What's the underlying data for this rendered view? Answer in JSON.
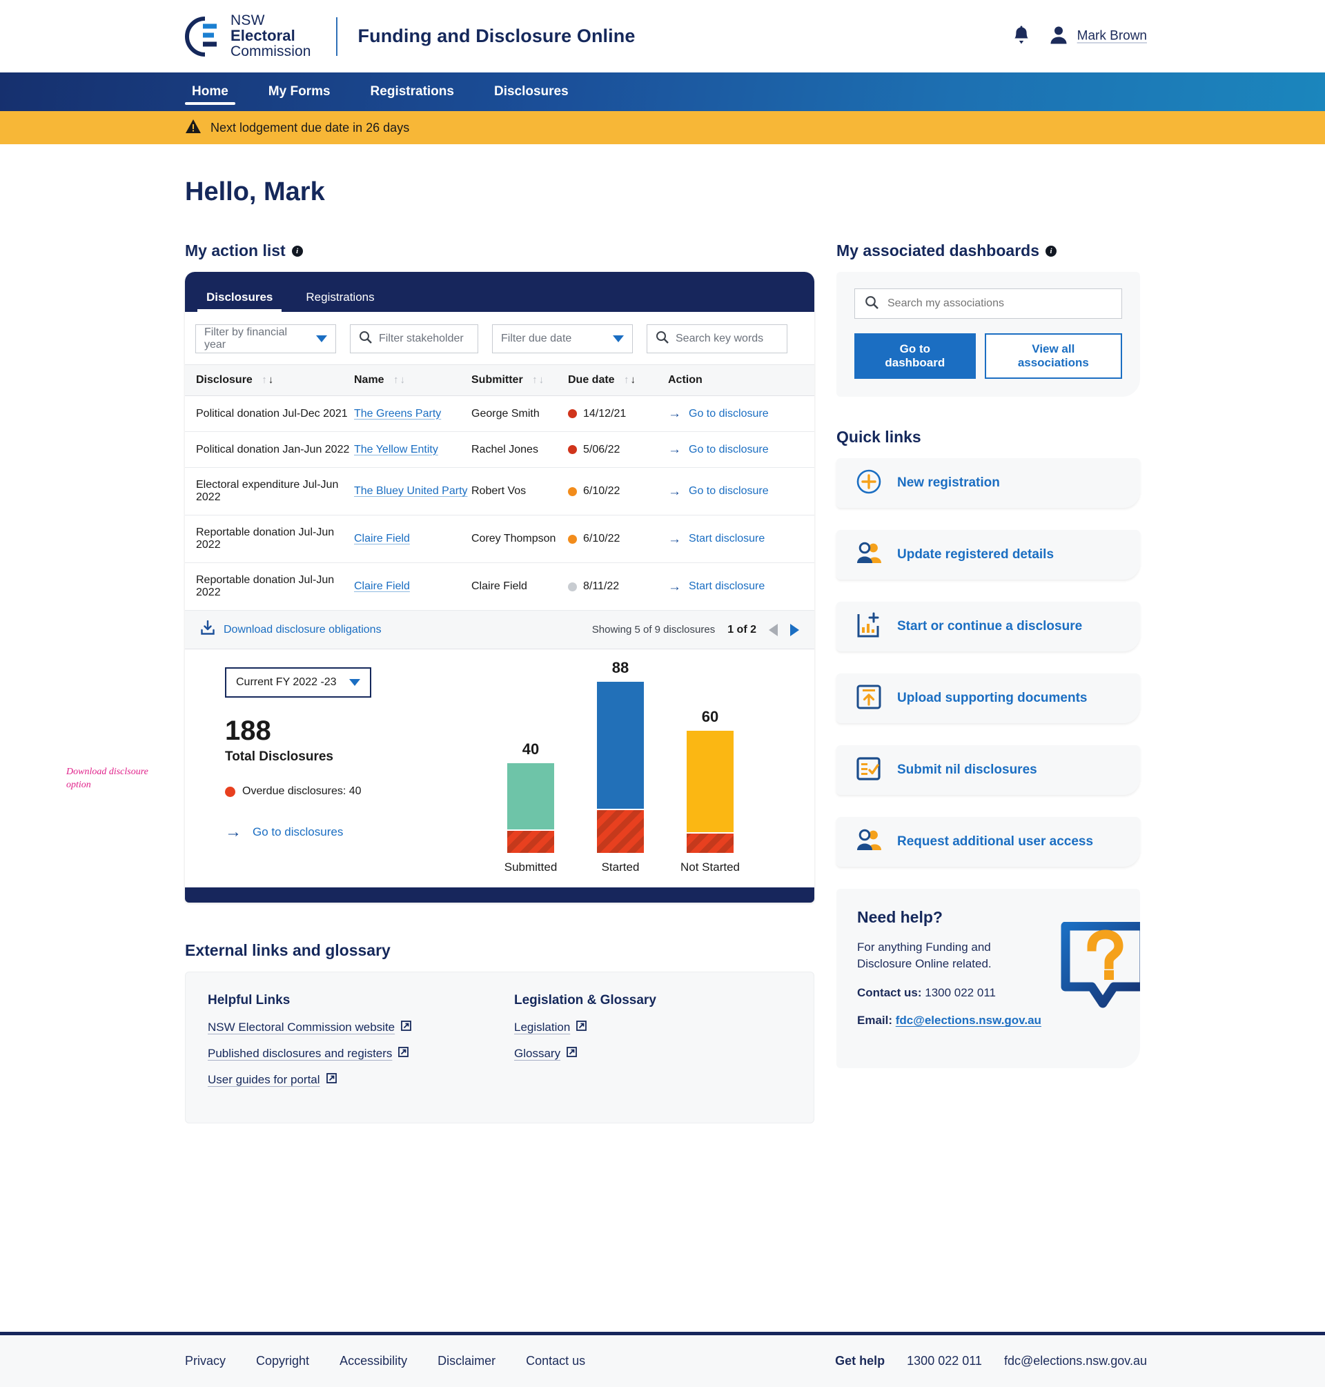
{
  "header": {
    "logo": {
      "line1": "NSW",
      "line2": "Electoral",
      "line3": "Commission"
    },
    "app_title": "Funding and Disclosure Online",
    "notifications_icon": "bell-icon",
    "avatar_icon": "user-avatar-icon",
    "user_name": "Mark Brown"
  },
  "nav": {
    "items": [
      {
        "label": "Home",
        "active": true
      },
      {
        "label": "My Forms",
        "active": false
      },
      {
        "label": "Registrations",
        "active": false
      },
      {
        "label": "Disclosures",
        "active": false
      }
    ]
  },
  "alert": {
    "icon": "warning-triangle-icon",
    "text": "Next lodgement due date in 26 days",
    "background": "#f7b737"
  },
  "greeting": "Hello, Mark",
  "action_list": {
    "title": "My action list",
    "info_icon": "info-icon",
    "tabs": [
      {
        "label": "Disclosures",
        "active": true
      },
      {
        "label": "Registrations",
        "active": false
      }
    ],
    "filters": [
      {
        "name": "financial-year",
        "placeholder": "Filter by financial year",
        "type": "select"
      },
      {
        "name": "stakeholder",
        "placeholder": "Filter stakeholder",
        "type": "search"
      },
      {
        "name": "due-date",
        "placeholder": "Filter due date",
        "type": "select"
      },
      {
        "name": "key-words",
        "placeholder": "Search key words",
        "type": "search"
      }
    ],
    "columns": [
      "Disclosure",
      "Name",
      "Submitter",
      "Due date",
      "Action"
    ],
    "rows": [
      {
        "disclosure": "Political donation Jul-Dec 2021",
        "name": "The Greens Party",
        "submitter": "George Smith",
        "due_date": "14/12/21",
        "status_color": "#d0341b",
        "action": "Go to disclosure"
      },
      {
        "disclosure": "Political donation Jan-Jun 2022",
        "name": "The Yellow Entity",
        "submitter": "Rachel Jones",
        "due_date": "5/06/22",
        "status_color": "#d0341b",
        "action": "Go to disclosure"
      },
      {
        "disclosure": "Electoral expenditure Jul-Jun 2022",
        "name": "The Bluey United Party",
        "submitter": "Robert Vos",
        "due_date": "6/10/22",
        "status_color": "#f28c1b",
        "action": "Go to disclosure"
      },
      {
        "disclosure": "Reportable donation Jul-Jun 2022",
        "name": "Claire Field",
        "submitter": "Corey Thompson",
        "due_date": "6/10/22",
        "status_color": "#f28c1b",
        "action": "Start disclosure"
      },
      {
        "disclosure": "Reportable donation Jul-Jun 2022",
        "name": "Claire Field",
        "submitter": "Claire Field",
        "due_date": "8/11/22",
        "status_color": "#c8ccd1",
        "action": "Start disclosure"
      }
    ],
    "download_label": "Download disclosure obligations",
    "download_icon": "download-icon",
    "showing_text": "Showing 5 of 9 disclosures",
    "page_text": "1 of 2",
    "prev_icon": "triangle-left-icon",
    "next_icon": "triangle-right-icon"
  },
  "annotation": "Download disclsoure option",
  "summary": {
    "fy_selected": "Current FY 2022 -23",
    "total_number": "188",
    "total_label": "Total Disclosures",
    "overdue_text": "Overdue disclosures: 40",
    "overdue_dot_color": "#e8401f",
    "goto_label": "Go to disclosures"
  },
  "chart_data": {
    "type": "bar",
    "title": "",
    "categories": [
      "Submitted",
      "Started",
      "Not Started"
    ],
    "values": [
      40,
      88,
      60
    ],
    "series": [
      {
        "name": "Total",
        "values": [
          40,
          88,
          60
        ]
      },
      {
        "name": "Overdue (hatched)",
        "values": [
          8,
          22,
          7
        ]
      }
    ],
    "bar_colors": [
      "#6ec4a8",
      "#2270b8",
      "#fbb713"
    ],
    "overdue_color": "#d94526",
    "data_labels": [
      40,
      88,
      60
    ],
    "xlabel": "",
    "ylabel": "",
    "ylim": [
      0,
      100
    ],
    "grid": false,
    "legend": "none"
  },
  "external": {
    "title": "External links and glossary",
    "groups": [
      {
        "heading": "Helpful Links",
        "links": [
          "NSW Electoral Commission website",
          "Published disclosures and registers",
          "User guides for portal"
        ]
      },
      {
        "heading": "Legislation & Glossary",
        "links": [
          "Legislation",
          "Glossary"
        ]
      }
    ],
    "external_icon": "external-link-icon"
  },
  "dashboards": {
    "title": "My associated dashboards",
    "info_icon": "info-icon",
    "search_placeholder": "Search my associations",
    "search_value": "",
    "search_icon": "search-icon",
    "primary_button": "Go to dashboard",
    "secondary_button": "View all associations"
  },
  "quick_links": {
    "title": "Quick links",
    "items": [
      {
        "label": "New registration",
        "icon": "plus-circle-icon"
      },
      {
        "label": "Update registered details",
        "icon": "users-icon"
      },
      {
        "label": "Start or continue a disclosure",
        "icon": "chart-plus-icon"
      },
      {
        "label": "Upload supporting documents",
        "icon": "upload-box-icon"
      },
      {
        "label": "Submit nil disclosures",
        "icon": "checklist-icon"
      },
      {
        "label": "Request additional user access",
        "icon": "users-icon"
      }
    ]
  },
  "help": {
    "title": "Need help?",
    "body": "For anything Funding and Disclosure Online related.",
    "contact_label": "Contact us:",
    "contact_value": "1300 022 011",
    "email_label": "Email:",
    "email_value": "fdc@elections.nsw.gov.au",
    "icon": "question-speech-bubble-icon"
  },
  "footer": {
    "links": [
      "Privacy",
      "Copyright",
      "Accessibility",
      "Disclaimer",
      "Contact us"
    ],
    "get_help": "Get help",
    "phone": "1300 022 011",
    "email": "fdc@elections.nsw.gov.au"
  }
}
